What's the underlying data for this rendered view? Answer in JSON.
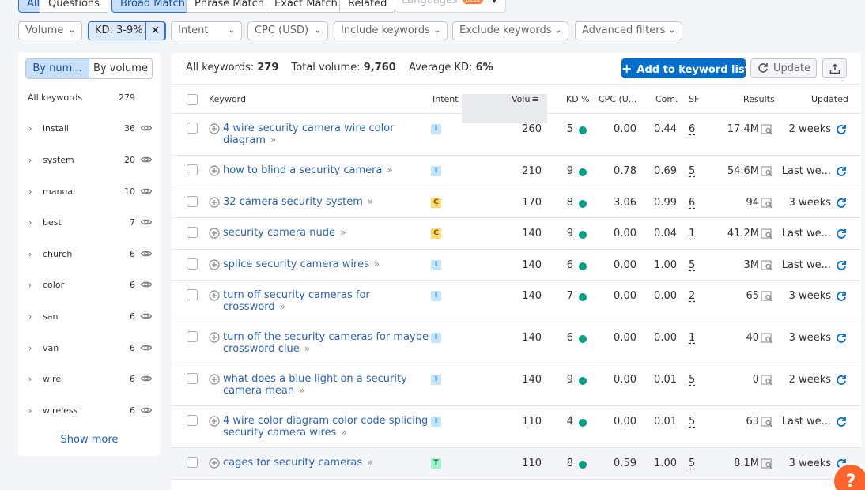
{
  "tabs": {
    "all": "All",
    "questions": "Questions",
    "broad": "Broad Match",
    "phrase": "Phrase Match",
    "exact": "Exact Match",
    "related": "Related"
  },
  "languages": {
    "label": "Languages",
    "badge": "beta"
  },
  "filters": {
    "volume": "Volume",
    "kd": "KD: 3-9%",
    "intent": "Intent",
    "cpc": "CPC (USD)",
    "include": "Include keywords",
    "exclude": "Exclude keywords",
    "advanced": "Advanced filters"
  },
  "sidebar": {
    "toggle_num": "By num...",
    "toggle_vol": "By volume",
    "all_label": "All keywords",
    "all_count": "279",
    "items": [
      {
        "label": "install",
        "count": "36"
      },
      {
        "label": "system",
        "count": "20"
      },
      {
        "label": "manual",
        "count": "10"
      },
      {
        "label": "best",
        "count": "7"
      },
      {
        "label": "church",
        "count": "6"
      },
      {
        "label": "color",
        "count": "6"
      },
      {
        "label": "san",
        "count": "6"
      },
      {
        "label": "van",
        "count": "6"
      },
      {
        "label": "wire",
        "count": "6"
      },
      {
        "label": "wireless",
        "count": "6"
      }
    ],
    "show_more": "Show more"
  },
  "summary": {
    "all_label": "All keywords:",
    "all_value": "279",
    "vol_label": "Total volume:",
    "vol_value": "9,760",
    "kd_label": "Average KD:",
    "kd_value": "6%"
  },
  "actions": {
    "add": "Add to keyword list",
    "update": "Update"
  },
  "columns": {
    "keyword": "Keyword",
    "intent": "Intent",
    "volume": "Volu",
    "kd": "KD %",
    "cpc": "CPC (U...",
    "com": "Com.",
    "sf": "SF",
    "results": "Results",
    "updated": "Updated"
  },
  "colors": {
    "accent": "#006dca",
    "kd_dot": "#009f81",
    "help": "#ff642d"
  },
  "rows": [
    {
      "kw": "4 wire security camera wire color diagram",
      "intent": "I",
      "vol": "260",
      "kd": "5",
      "cpc": "0.00",
      "com": "0.44",
      "sf": "6",
      "res": "17.4M",
      "upd": "2 weeks"
    },
    {
      "kw": "how to blind a security camera",
      "intent": "I",
      "vol": "210",
      "kd": "9",
      "cpc": "0.78",
      "com": "0.69",
      "sf": "5",
      "res": "54.6M",
      "upd": "Last we..."
    },
    {
      "kw": "32 camera security system",
      "intent": "C",
      "vol": "170",
      "kd": "8",
      "cpc": "3.06",
      "com": "0.99",
      "sf": "6",
      "res": "94",
      "upd": "3 weeks"
    },
    {
      "kw": "security camera nude",
      "intent": "C",
      "vol": "140",
      "kd": "9",
      "cpc": "0.00",
      "com": "0.04",
      "sf": "1",
      "res": "41.2M",
      "upd": "Last we..."
    },
    {
      "kw": "splice security camera wires",
      "intent": "I",
      "vol": "140",
      "kd": "6",
      "cpc": "0.00",
      "com": "1.00",
      "sf": "5",
      "res": "3M",
      "upd": "Last we..."
    },
    {
      "kw": "turn off security cameras for crossword",
      "intent": "I",
      "vol": "140",
      "kd": "7",
      "cpc": "0.00",
      "com": "0.00",
      "sf": "2",
      "res": "65",
      "upd": "3 weeks"
    },
    {
      "kw": "turn off the security cameras for maybe crossword clue",
      "intent": "I",
      "vol": "140",
      "kd": "6",
      "cpc": "0.00",
      "com": "0.00",
      "sf": "1",
      "res": "40",
      "upd": "3 weeks"
    },
    {
      "kw": "what does a blue light on a security camera mean",
      "intent": "I",
      "vol": "140",
      "kd": "9",
      "cpc": "0.00",
      "com": "0.01",
      "sf": "5",
      "res": "0",
      "upd": "2 weeks"
    },
    {
      "kw": "4 wire color diagram color code splicing security camera wires",
      "intent": "I",
      "vol": "110",
      "kd": "4",
      "cpc": "0.00",
      "com": "0.01",
      "sf": "5",
      "res": "63",
      "upd": "Last we..."
    },
    {
      "kw": "cages for security cameras",
      "intent": "T",
      "vol": "110",
      "kd": "8",
      "cpc": "0.59",
      "com": "1.00",
      "sf": "5",
      "res": "8.1M",
      "upd": "3 weeks"
    }
  ],
  "help": "?"
}
